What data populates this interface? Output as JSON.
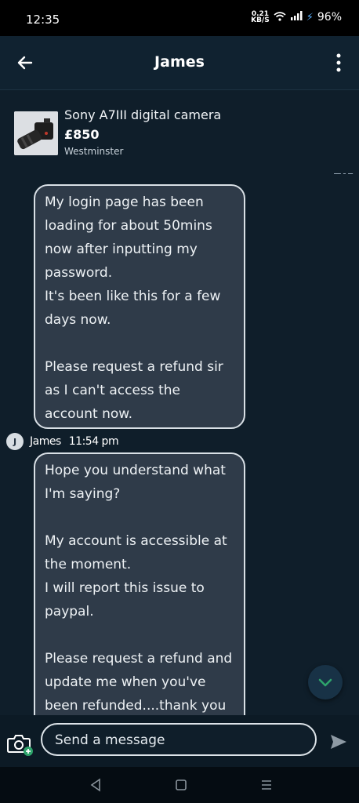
{
  "status": {
    "time": "12:35",
    "speed_value": "0.21",
    "speed_unit": "KB/S",
    "battery": "96%"
  },
  "header": {
    "title": "James"
  },
  "listing": {
    "title": "Sony A7III digital camera",
    "price": "£850",
    "location": "Westminster"
  },
  "messages": [
    {
      "text": "My login page has been loading for about 50mins now after inputting my password.\nIt's been like this for a few days now.\n\nPlease request a refund sir as I can't access the account now."
    },
    {
      "sender_initial": "J",
      "sender_name": "James",
      "time": "11:54 pm",
      "text": "Hope you understand what I'm saying?\n\nMy account is accessible at the moment.\nI will report this issue to paypal.\n\nPlease request a refund and update me when you've been refunded....thank you"
    }
  ],
  "composer": {
    "placeholder": "Send a message"
  },
  "colors": {
    "background": "#0f1e2a",
    "bubble": "#2f3b49",
    "accent_green": "#2ea36b"
  }
}
